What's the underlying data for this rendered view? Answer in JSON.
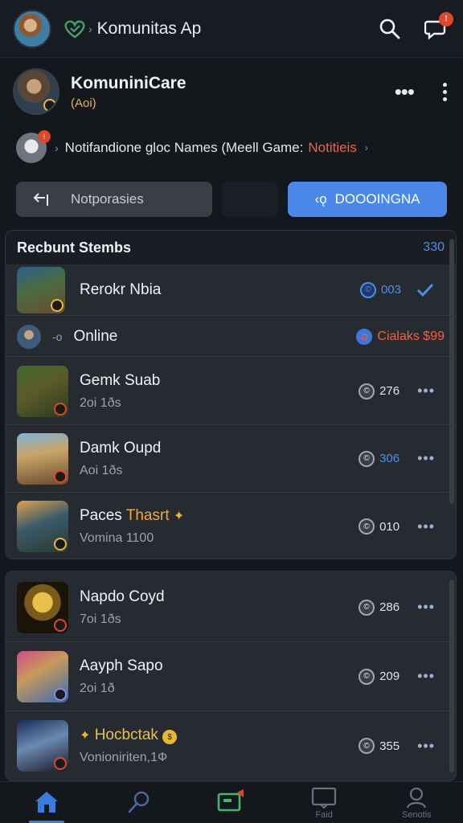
{
  "topbar": {
    "title": "Komunitas Ap",
    "avatar_icon": "user-avatar",
    "logo_icon": "community-logo-icon",
    "search_icon": "search-icon",
    "chat_icon": "chat-icon",
    "chat_badge": "!"
  },
  "profile": {
    "name": "KomuniniCare",
    "subtitle": "(Aoi)"
  },
  "notification": {
    "text": "Notifandione gloc Names (Meell Game:",
    "link": "Notitieis",
    "badge": "!"
  },
  "buttons": {
    "left_label": "Notporasies",
    "right_label": "DOOOINGNA",
    "right_icon": "‹ǫ"
  },
  "recent": {
    "title": "Recbunt Stembs",
    "count": "330",
    "top_item": {
      "title": "Rerokr Nbia",
      "value": "003",
      "status": "verified"
    },
    "online": {
      "label": "Online",
      "badge_text": "Cialaks $99"
    },
    "items": [
      {
        "title": "Gemk Suab",
        "subtitle": "2oi 1ðs",
        "value": "276",
        "value_blue": false
      },
      {
        "title": "Damk Oupd",
        "subtitle": "Aoi 1ðs",
        "value": "306",
        "value_blue": true
      },
      {
        "title": "Paces",
        "title_accent": "Thasrt",
        "subtitle": "Vomina 1100",
        "value": "010",
        "value_blue": false
      }
    ]
  },
  "second_list": {
    "items": [
      {
        "title": "Napdo Coyd",
        "subtitle": "7oi 1ðs",
        "value": "286"
      },
      {
        "title": "Aayph Sapo",
        "subtitle": "2oi 1ð",
        "value": "209"
      },
      {
        "title": "Hocbctak",
        "subtitle": "Vonioniriten,1Ф",
        "value": "355"
      }
    ]
  },
  "nav": {
    "items": [
      "",
      "",
      "",
      "Faid",
      "Senotis"
    ]
  },
  "colors": {
    "accent": "#4a87e8",
    "alert": "#e0462c",
    "gold": "#e0b64a",
    "background": "#14171c"
  }
}
